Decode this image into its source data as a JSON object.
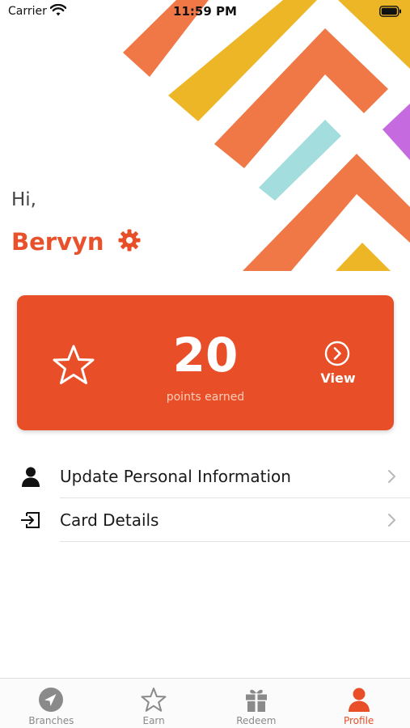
{
  "status_bar": {
    "carrier": "Carrier",
    "time": "11:59 PM"
  },
  "greeting": {
    "hi": "Hi,",
    "name": "Bervyn"
  },
  "points_card": {
    "value": "20",
    "label": "points earned",
    "view_label": "View"
  },
  "menu": {
    "items": [
      {
        "label": "Update Personal Information",
        "icon": "person-icon"
      },
      {
        "label": "Card Details",
        "icon": "sign-in-icon"
      }
    ]
  },
  "tab_bar": {
    "tabs": [
      {
        "label": "Branches",
        "icon": "navigation-icon"
      },
      {
        "label": "Earn",
        "icon": "star-icon"
      },
      {
        "label": "Redeem",
        "icon": "gift-icon"
      },
      {
        "label": "Profile",
        "icon": "person-icon"
      }
    ],
    "active": "Profile"
  },
  "colors": {
    "accent": "#e84f28",
    "banner_orange": "#ef7846",
    "banner_yellow": "#ecb626",
    "banner_teal": "#a3dddd",
    "banner_purple": "#c66ae0"
  }
}
